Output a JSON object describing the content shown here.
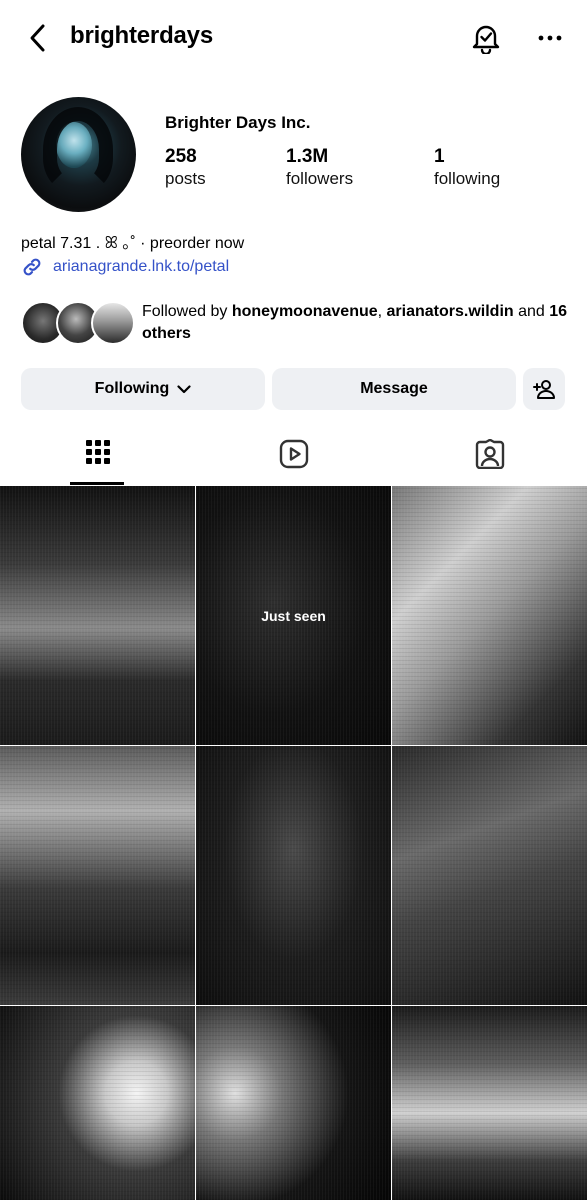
{
  "header": {
    "username": "brighterdays",
    "icons": {
      "back": "chevron-left-icon",
      "notifications": "bell-check-icon",
      "more": "more-horizontal-icon"
    }
  },
  "profile": {
    "display_name": "Brighter Days Inc.",
    "stats": {
      "posts": {
        "value": "258",
        "label": "posts"
      },
      "followers": {
        "value": "1.3M",
        "label": "followers"
      },
      "following": {
        "value": "1",
        "label": "following"
      }
    },
    "bio": "petal 7.31 . ꕤ ｡˚ · preorder now",
    "link": "arianagrande.lnk.to/petal",
    "followed_by": {
      "prefix": "Followed by ",
      "user1": "honeymoonavenue",
      "separator": ", ",
      "user2": "arianators.wildin",
      "and": " and ",
      "others": "16 others"
    }
  },
  "actions": {
    "following_label": "Following",
    "message_label": "Message"
  },
  "tabs": [
    {
      "icon": "grid-icon",
      "active": true
    },
    {
      "icon": "reels-icon",
      "active": false
    },
    {
      "icon": "tagged-icon",
      "active": false
    }
  ],
  "grid": {
    "overlay_label": "Just seen",
    "post_count_visible": 9
  },
  "colors": {
    "link": "#3552c8",
    "button_bg": "#eef0f3",
    "text": "#000000"
  }
}
